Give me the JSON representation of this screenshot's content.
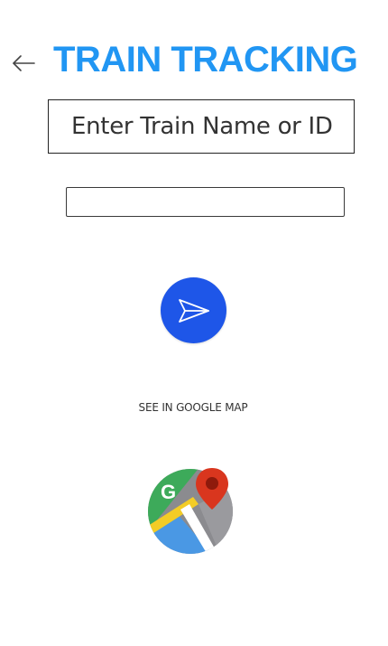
{
  "header": {
    "back_icon": "arrow-left-icon",
    "title": "TRAIN TRACKING",
    "title_color": "#2196f3"
  },
  "search": {
    "label": "Enter Train Name or ID",
    "value": "",
    "placeholder": ""
  },
  "send_button": {
    "icon": "send-icon",
    "color": "#1e56e8"
  },
  "map": {
    "link_label": "SEE IN GOOGLE MAP",
    "icon": "google-maps-icon"
  }
}
